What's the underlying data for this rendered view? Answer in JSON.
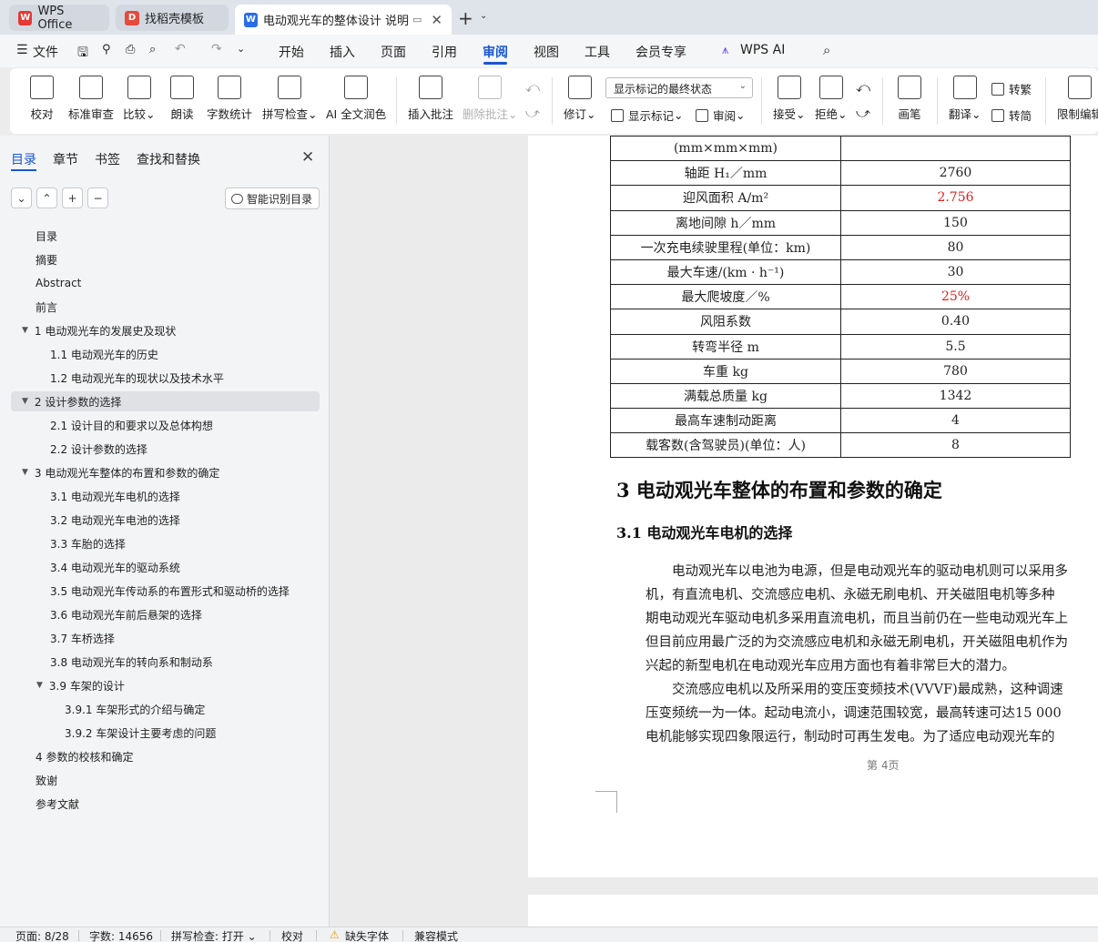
{
  "tabs": [
    {
      "label": "WPS Office",
      "icon": "wps-logo-icon"
    },
    {
      "label": "找稻壳模板",
      "icon": "docer-icon"
    },
    {
      "label": "电动观光车的整体设计 说明书",
      "icon": "word-doc-icon"
    }
  ],
  "menu": {
    "file": "文件",
    "items": [
      "开始",
      "插入",
      "页面",
      "引用",
      "审阅",
      "视图",
      "工具",
      "会员专享",
      "WPS AI"
    ],
    "active": "审阅"
  },
  "ribbon": {
    "proofread": "校对",
    "standard_review": "标准审查",
    "compare": "比较",
    "read_aloud": "朗读",
    "word_count": "字数统计",
    "spell_check": "拼写检查",
    "ai_polish": "AI 全文润色",
    "insert_comment": "插入批注",
    "delete_comment": "删除批注",
    "track_changes": "修订",
    "markup_select": "显示标记的最终状态",
    "show_markup": "显示标记",
    "review": "审阅",
    "accept": "接受",
    "reject": "拒绝",
    "pen": "画笔",
    "translate": "翻译",
    "to_traditional": "转繁",
    "to_simplified": "转简",
    "restrict_edit": "限制编辑"
  },
  "sidebar": {
    "tabs": [
      "目录",
      "章节",
      "书签",
      "查找和替换"
    ],
    "smart_btn": "智能识别目录",
    "toc": [
      {
        "label": "目录",
        "level": 0
      },
      {
        "label": "摘要",
        "level": 0
      },
      {
        "label": "Abstract",
        "level": 0
      },
      {
        "label": "前言",
        "level": 0
      },
      {
        "label": "1 电动观光车的发展史及现状",
        "level": 0,
        "arrow": true
      },
      {
        "label": "1.1 电动观光车的历史",
        "level": 1
      },
      {
        "label": "1.2 电动观光车的现状以及技术水平",
        "level": 1
      },
      {
        "label": "2 设计参数的选择",
        "level": 0,
        "arrow": true,
        "selected": true
      },
      {
        "label": "2.1   设计目的和要求以及总体构想",
        "level": 1
      },
      {
        "label": "2.2 设计参数的选择",
        "level": 1
      },
      {
        "label": "3 电动观光车整体的布置和参数的确定",
        "level": 0,
        "arrow": true
      },
      {
        "label": "3.1 电动观光车电机的选择",
        "level": 1
      },
      {
        "label": "3.2 电动观光车电池的选择",
        "level": 1
      },
      {
        "label": "3.3 车胎的选择",
        "level": 1
      },
      {
        "label": "3.4 电动观光车的驱动系统",
        "level": 1
      },
      {
        "label": "3.5 电动观光车传动系的布置形式和驱动桥的选择",
        "level": 1
      },
      {
        "label": "3.6 电动观光车前后悬架的选择",
        "level": 1
      },
      {
        "label": "3.7 车桥选择",
        "level": 1
      },
      {
        "label": "3.8 电动观光车的转向系和制动系",
        "level": 1
      },
      {
        "label": "3.9 车架的设计",
        "level": 1,
        "arrow": true
      },
      {
        "label": "3.9.1 车架形式的介绍与确定",
        "level": 2
      },
      {
        "label": "3.9.2 车架设计主要考虑的问题",
        "level": 2
      },
      {
        "label": "4 参数的校核和确定",
        "level": 0
      },
      {
        "label": "致谢",
        "level": 0
      },
      {
        "label": "参考文献",
        "level": 0
      }
    ]
  },
  "doc": {
    "table": [
      {
        "param": "(mm×mm×mm)",
        "value": ""
      },
      {
        "param": "轴距 H₁／mm",
        "value": "2760"
      },
      {
        "param": "迎风面积 A/m²",
        "value": "2.756",
        "red": true
      },
      {
        "param": "离地间隙 h／mm",
        "value": "150"
      },
      {
        "param": "一次充电续驶里程(单位：km)",
        "value": "80"
      },
      {
        "param": "最大车速/(km · h⁻¹)",
        "value": "30"
      },
      {
        "param": "最大爬坡度／%",
        "value": "25%",
        "red": true
      },
      {
        "param": "风阻系数",
        "value": "0.40"
      },
      {
        "param": "转弯半径 m",
        "value": "5.5"
      },
      {
        "param": "车重 kg",
        "value": "780"
      },
      {
        "param": "满载总质量 kg",
        "value": "1342"
      },
      {
        "param": "最高车速制动距离",
        "value": "4"
      },
      {
        "param": "载客数(含驾驶员)(单位：人)",
        "value": "8"
      }
    ],
    "heading1": "3  电动观光车整体的布置和参数的确定",
    "heading2": "3.1 电动观光车电机的选择",
    "lines": [
      "　　电动观光车以电池为电源，但是电动观光车的驱动电机则可以采用多",
      "机，有直流电机、交流感应电机、永磁无刷电机、开关磁阻电机等多种",
      "期电动观光车驱动电机多采用直流电机，而且当前仍在一些电动观光车上",
      "但目前应用最广泛的为交流感应电机和永磁无刷电机，开关磁阻电机作为",
      "兴起的新型电机在电动观光车应用方面也有着非常巨大的潜力。",
      "　　交流感应电机以及所采用的变压变频技术(VVVF)最成熟，这种调速",
      "压变频统一为一体。起动电流小，调速范围较宽，最高转速可达15 000",
      "电机能够实现四象限运行，制动时可再生发电。为了适应电动观光车的"
    ],
    "page_number": "第 4页"
  },
  "status": {
    "page": "页面: 8/28",
    "words": "字数: 14656",
    "spell": "拼写检查: 打开",
    "proof": "校对",
    "missing_font": "缺失字体",
    "compat": "兼容模式"
  }
}
